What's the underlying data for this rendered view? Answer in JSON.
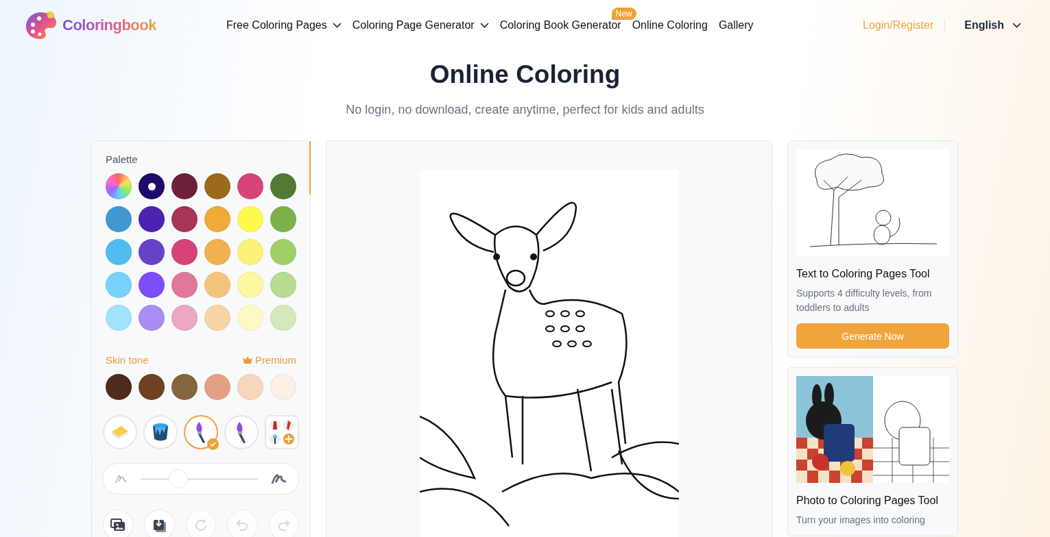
{
  "header": {
    "logo": "Coloringbook",
    "nav": [
      {
        "label": "Free Coloring Pages",
        "dropdown": true
      },
      {
        "label": "Coloring Page Generator",
        "dropdown": true
      },
      {
        "label": "Coloring Book Generator",
        "dropdown": false,
        "badge": "New"
      },
      {
        "label": "Online Coloring",
        "dropdown": false
      },
      {
        "label": "Gallery",
        "dropdown": false
      }
    ],
    "login": "Login/Register",
    "language": "English"
  },
  "hero": {
    "title": "Online Coloring",
    "subtitle": "No login, no download, create anytime, perfect for kids and adults"
  },
  "palette": {
    "label": "Palette",
    "swatches": [
      {
        "kind": "rainbow",
        "selected": false
      },
      {
        "kind": "solid",
        "color": "#1f0a6b",
        "selected": true
      },
      {
        "kind": "solid",
        "color": "#6e1f3a",
        "selected": false
      },
      {
        "kind": "solid",
        "color": "#9c6a1c",
        "selected": false
      },
      {
        "kind": "solid",
        "color": "#d6457a",
        "selected": false
      },
      {
        "kind": "solid",
        "color": "#537a32",
        "selected": false
      },
      {
        "kind": "solid",
        "color": "#4299d1",
        "selected": false
      },
      {
        "kind": "solid",
        "color": "#4b23b0",
        "selected": false
      },
      {
        "kind": "solid",
        "color": "#a83558",
        "selected": false
      },
      {
        "kind": "solid",
        "color": "#f0aa3a",
        "selected": false
      },
      {
        "kind": "solid",
        "color": "#fff84d",
        "selected": false
      },
      {
        "kind": "solid",
        "color": "#7db24a",
        "selected": false
      },
      {
        "kind": "solid",
        "color": "#50bdf2",
        "selected": false
      },
      {
        "kind": "solid",
        "color": "#6543c9",
        "selected": false
      },
      {
        "kind": "solid",
        "color": "#d54379",
        "selected": false
      },
      {
        "kind": "solid",
        "color": "#f2b050",
        "selected": false
      },
      {
        "kind": "solid",
        "color": "#fbf27a",
        "selected": false
      },
      {
        "kind": "solid",
        "color": "#9fd068",
        "selected": false
      },
      {
        "kind": "solid",
        "color": "#77d2f9",
        "selected": false
      },
      {
        "kind": "solid",
        "color": "#7b4ef7",
        "selected": false
      },
      {
        "kind": "solid",
        "color": "#e0789d",
        "selected": false
      },
      {
        "kind": "solid",
        "color": "#f4c47e",
        "selected": false
      },
      {
        "kind": "solid",
        "color": "#fdf7a0",
        "selected": false
      },
      {
        "kind": "solid",
        "color": "#b7dc92",
        "selected": false
      },
      {
        "kind": "solid",
        "color": "#a4e1fb",
        "selected": false
      },
      {
        "kind": "solid",
        "color": "#a98cf5",
        "selected": false
      },
      {
        "kind": "solid",
        "color": "#eca7c2",
        "selected": false
      },
      {
        "kind": "solid",
        "color": "#f6d6a7",
        "selected": false
      },
      {
        "kind": "solid",
        "color": "#fdf9c4",
        "selected": false
      },
      {
        "kind": "solid",
        "color": "#d3e8bd",
        "selected": false
      }
    ],
    "skin_label": "Skin tone",
    "premium": "Premium",
    "skin_swatches": [
      {
        "color": "#4f2b1b",
        "selected": false
      },
      {
        "color": "#6d4121",
        "selected": false
      },
      {
        "color": "#85653f",
        "selected": false
      },
      {
        "color": "#e4a086",
        "selected": false
      },
      {
        "color": "#f8d6bb",
        "selected": false
      },
      {
        "color": "#fcefe6",
        "selected": false
      }
    ]
  },
  "tools": [
    {
      "kind": "eraser",
      "selected": false
    },
    {
      "kind": "bucket",
      "selected": false
    },
    {
      "kind": "brush",
      "selected": true
    },
    {
      "kind": "brush",
      "selected": false
    },
    {
      "kind": "more",
      "selected": false
    }
  ],
  "brush_size": {
    "level": 0.32
  },
  "actions": [
    {
      "kind": "gallery",
      "disabled": false
    },
    {
      "kind": "download",
      "disabled": false
    },
    {
      "kind": "reset",
      "disabled": true
    },
    {
      "kind": "undo",
      "disabled": true
    },
    {
      "kind": "redo",
      "disabled": true
    }
  ],
  "cards": [
    {
      "kind": "picture",
      "title": "Text to Coloring Pages Tool",
      "description": "Supports 4 difficulty levels, from toddlers to adults",
      "button": "Generate Now"
    },
    {
      "kind": "picture",
      "title": "Photo to Coloring Pages Tool",
      "description": "Turn your images into coloring"
    }
  ]
}
